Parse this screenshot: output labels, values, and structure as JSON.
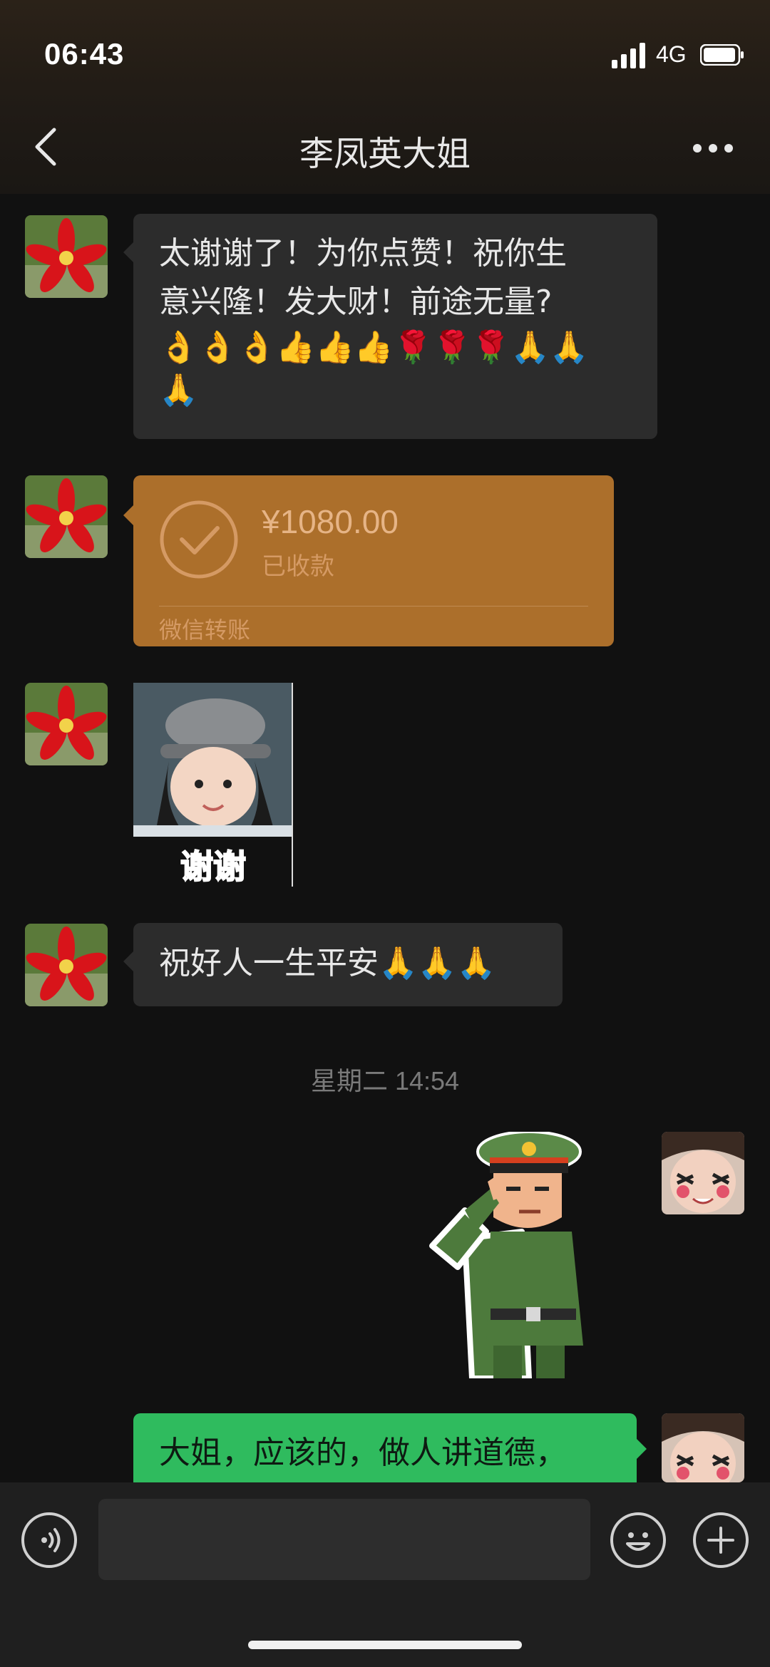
{
  "status_bar": {
    "time": "06:43",
    "network": "4G"
  },
  "header": {
    "title": "李凤英大姐"
  },
  "messages": {
    "m1": {
      "line1": "太谢谢了！为你点赞！祝你生",
      "line2": "意兴隆！发大财！前途无量?"
    },
    "transfer": {
      "amount": "¥1080.00",
      "status": "已收款",
      "label": "微信转账"
    },
    "sticker": {
      "caption": "谢谢"
    },
    "m4": {
      "text": "祝好人一生平安"
    },
    "timestamp": "星期二 14:54",
    "m6": {
      "text": "大姐，应该的，做人讲道德，"
    }
  },
  "colors": {
    "transfer_bg": "#ac6f2b",
    "sent_bubble": "#2fbb5e",
    "received_bubble": "#2c2c2c"
  }
}
